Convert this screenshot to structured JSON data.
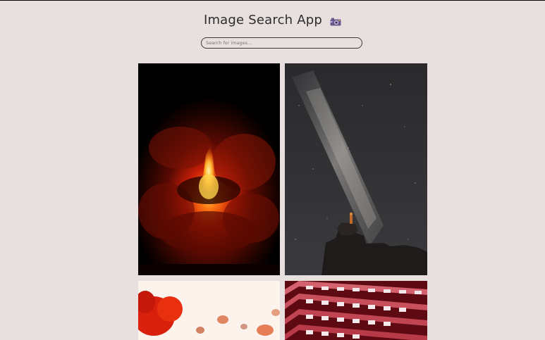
{
  "header": {
    "title": "Image Search App"
  },
  "search": {
    "placeholder": "Search for images...",
    "value": ""
  },
  "images": [
    {
      "subject": "volcano eruption at night",
      "icon": "volcano-image"
    },
    {
      "subject": "milky way over rocky outcrop with person",
      "icon": "milky-way-image"
    },
    {
      "subject": "red poppy flowers",
      "icon": "poppy-image"
    },
    {
      "subject": "red building facade with white balconies",
      "icon": "building-image"
    }
  ],
  "colors": {
    "background": "#e8dfdf",
    "text": "#2d2d2d",
    "border": "#3a3a3a"
  }
}
